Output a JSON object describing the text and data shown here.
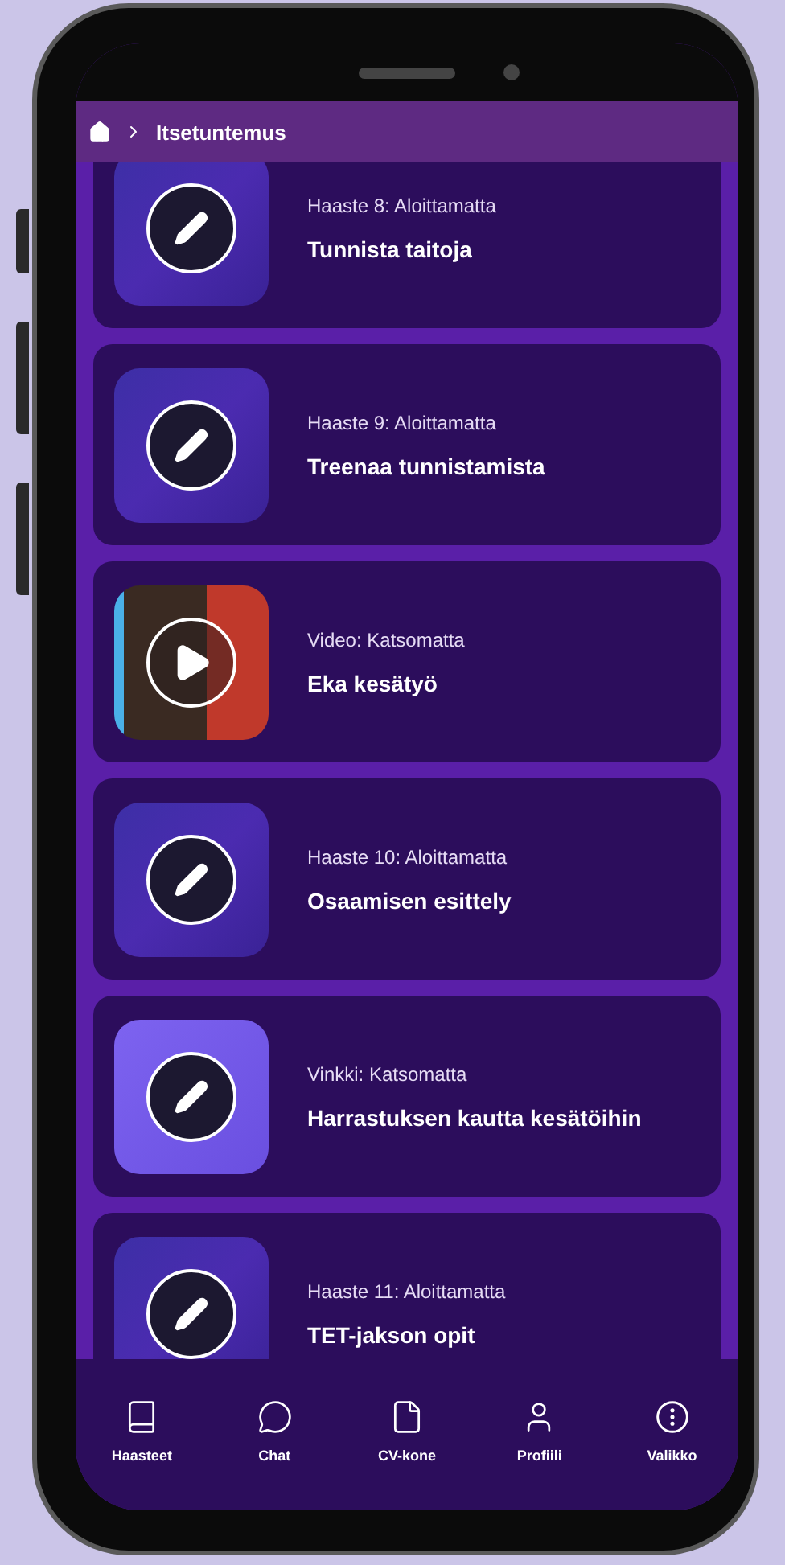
{
  "breadcrumb": {
    "current": "Itsetuntemus"
  },
  "items": [
    {
      "kind": "challenge",
      "status": "Haaste 8: Aloittamatta",
      "title": "Tunnista taitoja"
    },
    {
      "kind": "challenge",
      "status": "Haaste 9: Aloittamatta",
      "title": "Treenaa tunnistamista"
    },
    {
      "kind": "video",
      "status": "Video: Katsomatta",
      "title": "Eka kesätyö"
    },
    {
      "kind": "challenge",
      "status": "Haaste 10: Aloittamatta",
      "title": "Osaamisen esittely"
    },
    {
      "kind": "tip",
      "status": "Vinkki: Katsomatta",
      "title": "Harrastuksen kautta kesätöihin"
    },
    {
      "kind": "challenge",
      "status": "Haaste 11: Aloittamatta",
      "title": "TET-jakson opit"
    }
  ],
  "nav": [
    {
      "kind": "book",
      "label": "Haasteet"
    },
    {
      "kind": "chat",
      "label": "Chat"
    },
    {
      "kind": "file",
      "label": "CV-kone"
    },
    {
      "kind": "user",
      "label": "Profiili"
    },
    {
      "kind": "more",
      "label": "Valikko"
    }
  ]
}
